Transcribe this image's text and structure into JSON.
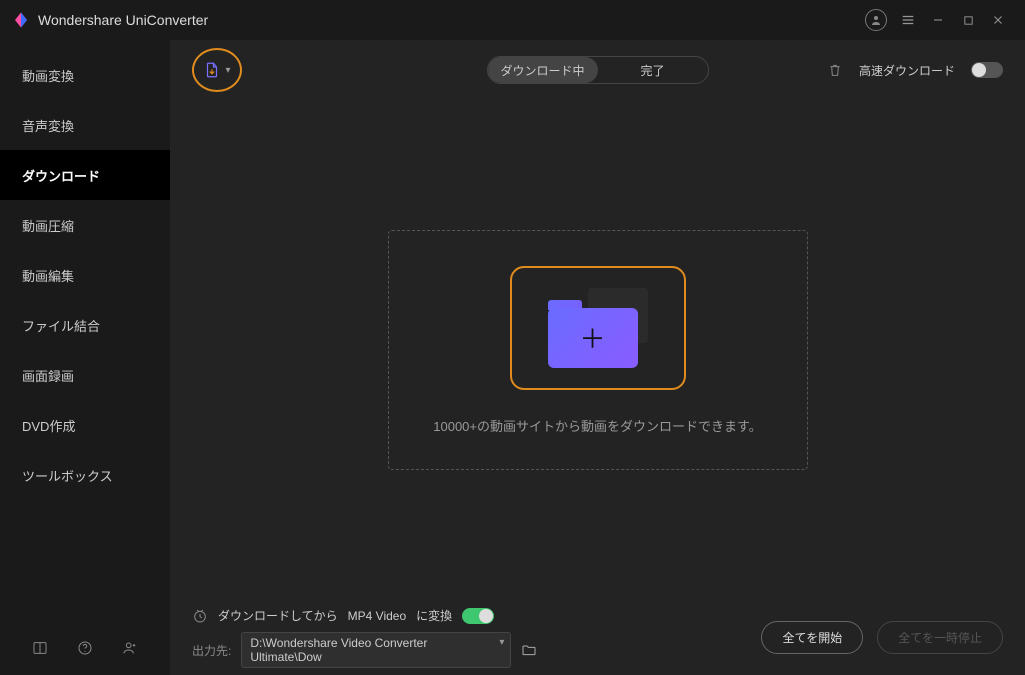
{
  "app": {
    "title": "Wondershare UniConverter"
  },
  "sidebar": {
    "items": [
      {
        "label": "動画変換"
      },
      {
        "label": "音声変換"
      },
      {
        "label": "ダウンロード"
      },
      {
        "label": "動画圧縮"
      },
      {
        "label": "動画編集"
      },
      {
        "label": "ファイル結合"
      },
      {
        "label": "画面録画"
      },
      {
        "label": "DVD作成"
      },
      {
        "label": "ツールボックス"
      }
    ],
    "active_index": 2
  },
  "tabs": {
    "downloading": "ダウンロード中",
    "finished": "完了"
  },
  "fast_download": {
    "label": "高速ダウンロード",
    "enabled": false
  },
  "empty_state": {
    "hint": "10000+の動画サイトから動画をダウンロードできます。"
  },
  "bottom": {
    "convert_after_label_prefix": "ダウンロードしてから",
    "convert_after_format": "MP4 Video",
    "convert_after_label_suffix": "に変換",
    "convert_after_enabled": true,
    "output_label": "出力先:",
    "output_path": "D:\\Wondershare Video Converter Ultimate\\Dow",
    "start_all": "全てを開始",
    "pause_all": "全てを一時停止"
  }
}
